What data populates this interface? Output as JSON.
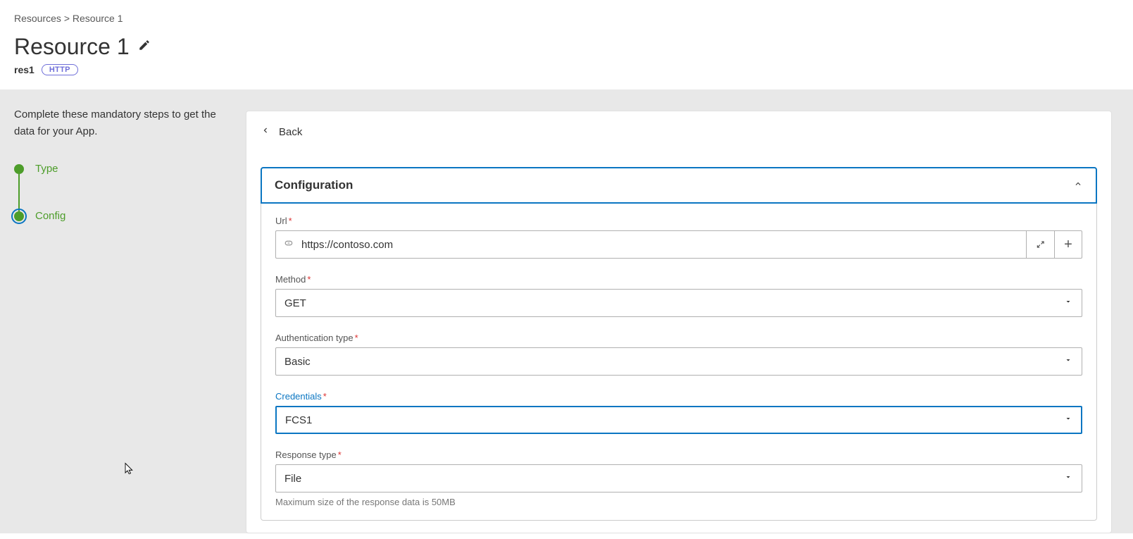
{
  "breadcrumb": {
    "root": "Resources",
    "sep": ">",
    "current": "Resource 1"
  },
  "header": {
    "title": "Resource 1",
    "shortName": "res1",
    "badge": "HTTP"
  },
  "sidebar": {
    "intro": "Complete these mandatory steps to get the data for your App.",
    "steps": [
      {
        "label": "Type"
      },
      {
        "label": "Config"
      }
    ]
  },
  "main": {
    "back": "Back",
    "panel": {
      "title": "Configuration",
      "fields": {
        "url": {
          "label": "Url",
          "value": "https://contoso.com"
        },
        "method": {
          "label": "Method",
          "value": "GET"
        },
        "auth": {
          "label": "Authentication type",
          "value": "Basic"
        },
        "credentials": {
          "label": "Credentials",
          "value": "FCS1"
        },
        "response": {
          "label": "Response type",
          "value": "File",
          "helper": "Maximum size of the response data is 50MB"
        }
      }
    }
  }
}
